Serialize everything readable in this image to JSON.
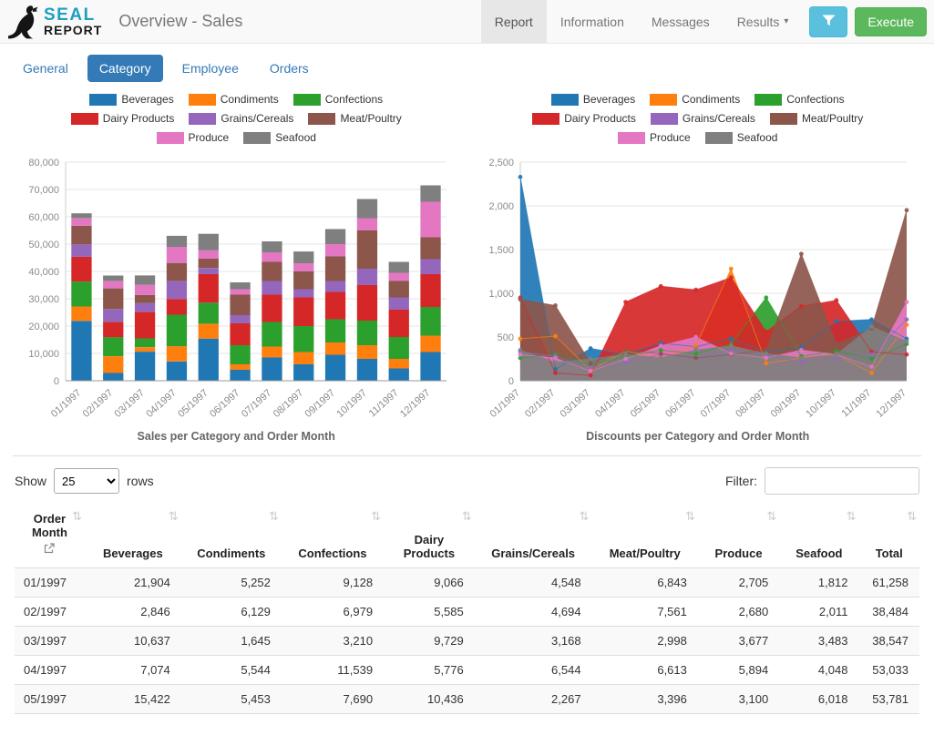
{
  "navbar": {
    "brand_line1": "SEAL",
    "brand_line2": "REPORT",
    "title": "Overview - Sales",
    "menu": [
      {
        "label": "Report",
        "active": true,
        "caret": false
      },
      {
        "label": "Information",
        "active": false,
        "caret": false
      },
      {
        "label": "Messages",
        "active": false,
        "caret": false
      },
      {
        "label": "Results",
        "active": false,
        "caret": true
      }
    ],
    "execute_label": "Execute"
  },
  "tabs": [
    {
      "label": "General",
      "active": false
    },
    {
      "label": "Category",
      "active": true
    },
    {
      "label": "Employee",
      "active": false
    },
    {
      "label": "Orders",
      "active": false
    }
  ],
  "colors": {
    "accent_blue": "#337ab7",
    "filter_button": "#5bc0de",
    "execute_button": "#5cb85c",
    "brand_teal": "#1d9fbe",
    "nav_active_bg": "#e7e7e7"
  },
  "chart_data": [
    {
      "type": "bar",
      "stacked": true,
      "title": "Sales per Category and Order Month",
      "xlabel": "",
      "ylabel": "",
      "ylim": [
        0,
        80000
      ],
      "ytick_step": 10000,
      "grid": true,
      "legend_position": "top",
      "categories": [
        "01/1997",
        "02/1997",
        "03/1997",
        "04/1997",
        "05/1997",
        "06/1997",
        "07/1997",
        "08/1997",
        "09/1997",
        "10/1997",
        "11/1997",
        "12/1997"
      ],
      "series": [
        {
          "name": "Beverages",
          "color": "#1f77b4",
          "values": [
            21904,
            2846,
            10637,
            7074,
            15422,
            4000,
            8500,
            6000,
            9500,
            8000,
            4500,
            10500
          ]
        },
        {
          "name": "Condiments",
          "color": "#ff7f0e",
          "values": [
            5252,
            6129,
            1645,
            5544,
            5453,
            2000,
            4000,
            4500,
            4500,
            5000,
            3500,
            6000
          ]
        },
        {
          "name": "Confections",
          "color": "#2ca02c",
          "values": [
            9128,
            6979,
            3210,
            11539,
            7690,
            7000,
            9000,
            9500,
            8500,
            9000,
            8000,
            10500
          ]
        },
        {
          "name": "Dairy Products",
          "color": "#d62728",
          "values": [
            9066,
            5585,
            9729,
            5776,
            10436,
            8000,
            10000,
            10500,
            10000,
            13000,
            10000,
            12000
          ]
        },
        {
          "name": "Grains/Cereals",
          "color": "#9467bd",
          "values": [
            4548,
            4694,
            3168,
            6544,
            2267,
            3000,
            5000,
            3000,
            4000,
            6000,
            4500,
            5500
          ]
        },
        {
          "name": "Meat/Poultry",
          "color": "#8c564b",
          "values": [
            6843,
            7561,
            2998,
            6613,
            3396,
            7500,
            7000,
            6500,
            9000,
            14000,
            6000,
            8000
          ]
        },
        {
          "name": "Produce",
          "color": "#e377c2",
          "values": [
            2705,
            2680,
            3677,
            5894,
            3100,
            2000,
            3500,
            3000,
            4500,
            4500,
            3000,
            13000
          ]
        },
        {
          "name": "Seafood",
          "color": "#7f7f7f",
          "values": [
            1812,
            2011,
            3483,
            4048,
            6018,
            2500,
            4000,
            4300,
            5500,
            7000,
            4000,
            6000
          ]
        }
      ]
    },
    {
      "type": "area",
      "stacked": false,
      "title": "Discounts per Category and Order Month",
      "xlabel": "",
      "ylabel": "",
      "ylim": [
        0,
        2500
      ],
      "ytick_step": 500,
      "grid": true,
      "legend_position": "top",
      "categories": [
        "01/1997",
        "02/1997",
        "03/1997",
        "04/1997",
        "05/1997",
        "06/1997",
        "07/1997",
        "08/1997",
        "09/1997",
        "10/1997",
        "11/1997",
        "12/1997"
      ],
      "series": [
        {
          "name": "Beverages",
          "color": "#1f77b4",
          "values": [
            2330,
            130,
            370,
            300,
            430,
            390,
            480,
            330,
            380,
            680,
            700,
            480
          ]
        },
        {
          "name": "Condiments",
          "color": "#ff7f0e",
          "values": [
            480,
            510,
            120,
            340,
            260,
            400,
            1280,
            200,
            260,
            300,
            90,
            640
          ]
        },
        {
          "name": "Confections",
          "color": "#2ca02c",
          "values": [
            260,
            300,
            180,
            280,
            350,
            310,
            420,
            950,
            280,
            340,
            250,
            420
          ]
        },
        {
          "name": "Dairy Products",
          "color": "#d62728",
          "values": [
            950,
            90,
            60,
            900,
            1080,
            1040,
            1180,
            560,
            850,
            920,
            330,
            300
          ]
        },
        {
          "name": "Grains/Cereals",
          "color": "#9467bd",
          "values": [
            330,
            280,
            150,
            210,
            300,
            260,
            350,
            300,
            210,
            260,
            300,
            700
          ]
        },
        {
          "name": "Meat/Poultry",
          "color": "#8c564b",
          "values": [
            930,
            860,
            200,
            350,
            310,
            260,
            300,
            350,
            1450,
            420,
            600,
            1950
          ]
        },
        {
          "name": "Produce",
          "color": "#e377c2",
          "values": [
            300,
            260,
            110,
            250,
            400,
            500,
            310,
            260,
            350,
            300,
            160,
            900
          ]
        },
        {
          "name": "Seafood",
          "color": "#7f7f7f",
          "values": [
            350,
            210,
            250,
            300,
            260,
            350,
            400,
            310,
            260,
            300,
            620,
            450
          ]
        }
      ]
    }
  ],
  "controls": {
    "show_label": "Show",
    "rows_value": "25",
    "rows_label": "rows",
    "filter_label": "Filter:",
    "filter_value": ""
  },
  "table": {
    "columns": [
      "Order Month",
      "Beverages",
      "Condiments",
      "Confections",
      "Dairy Products",
      "Grains/Cereals",
      "Meat/Poultry",
      "Produce",
      "Seafood",
      "Total"
    ],
    "rows": [
      [
        "01/1997",
        "21,904",
        "5,252",
        "9,128",
        "9,066",
        "4,548",
        "6,843",
        "2,705",
        "1,812",
        "61,258"
      ],
      [
        "02/1997",
        "2,846",
        "6,129",
        "6,979",
        "5,585",
        "4,694",
        "7,561",
        "2,680",
        "2,011",
        "38,484"
      ],
      [
        "03/1997",
        "10,637",
        "1,645",
        "3,210",
        "9,729",
        "3,168",
        "2,998",
        "3,677",
        "3,483",
        "38,547"
      ],
      [
        "04/1997",
        "7,074",
        "5,544",
        "11,539",
        "5,776",
        "6,544",
        "6,613",
        "5,894",
        "4,048",
        "53,033"
      ],
      [
        "05/1997",
        "15,422",
        "5,453",
        "7,690",
        "10,436",
        "2,267",
        "3,396",
        "3,100",
        "6,018",
        "53,781"
      ]
    ]
  }
}
